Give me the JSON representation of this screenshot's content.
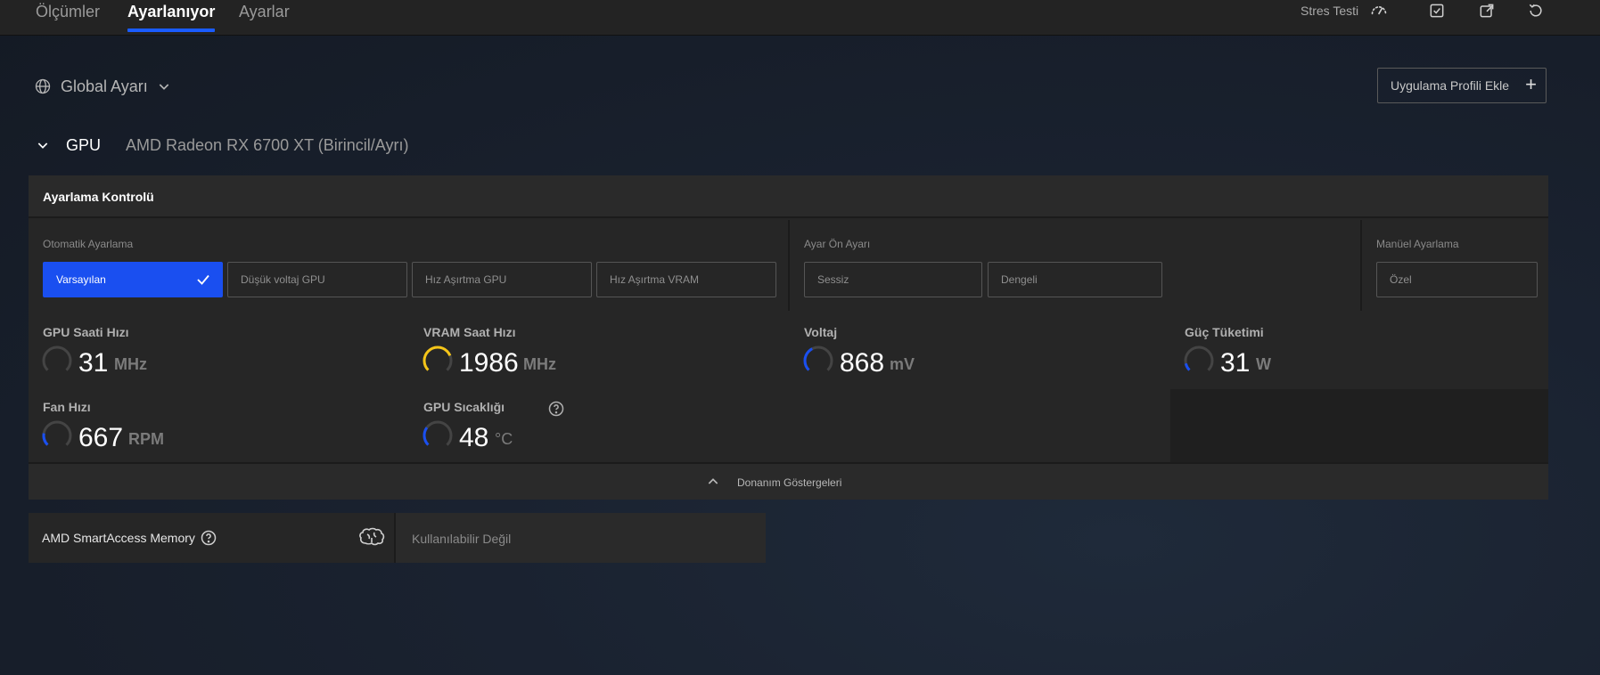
{
  "tabs": [
    {
      "label": "Ölçümler"
    },
    {
      "label": "Ayarlanıyor"
    },
    {
      "label": "Ayarlar"
    }
  ],
  "topbar": {
    "stress_test_label": "Stres Testi",
    "icons": [
      "gauge-icon",
      "apply-icon",
      "export-icon",
      "reset-icon"
    ]
  },
  "profile": {
    "global_label": "Global Ayarı",
    "add_profile_label": "Uygulama Profili Ekle"
  },
  "gpu": {
    "label": "GPU",
    "name": "AMD Radeon RX 6700 XT (Birincil/Ayrı)"
  },
  "tuning": {
    "title": "Ayarlama Kontrolü",
    "auto": {
      "label": "Otomatik Ayarlama",
      "options": [
        "Varsayılan",
        "Düşük voltaj GPU",
        "Hız Aşırtma GPU",
        "Hız Aşırtma VRAM"
      ],
      "selected": "Varsayılan"
    },
    "preset": {
      "label": "Ayar Ön Ayarı",
      "options": [
        "Sessiz",
        "Dengeli"
      ]
    },
    "manual": {
      "label": "Manüel Ayarlama",
      "options": [
        "Özel"
      ]
    }
  },
  "metrics": [
    {
      "label": "GPU Saati Hızı",
      "value": "31",
      "unit": "MHz",
      "gauge_color": "#444444",
      "gauge_fraction": 0.0
    },
    {
      "label": "VRAM Saat Hızı",
      "value": "1986",
      "unit": "MHz",
      "gauge_color": "#f5c518",
      "gauge_fraction": 0.75
    },
    {
      "label": "Voltaj",
      "value": "868",
      "unit": "mV",
      "gauge_color": "#1a4ff0",
      "gauge_fraction": 0.4
    },
    {
      "label": "Güç Tüketimi",
      "value": "31",
      "unit": "W",
      "gauge_color": "#1a4ff0",
      "gauge_fraction": 0.12
    },
    {
      "label": "Fan Hızı",
      "value": "667",
      "unit": "RPM",
      "gauge_color": "#1a4ff0",
      "gauge_fraction": 0.2
    },
    {
      "label": "GPU Sıcaklığı",
      "value": "48",
      "unit": "°C",
      "gauge_color": "#1a4ff0",
      "gauge_fraction": 0.3
    }
  ],
  "footer": {
    "label": "Donanım Göstergeleri"
  },
  "smart_access": {
    "label": "AMD SmartAccess Memory",
    "status": "Kullanılabilir Değil"
  },
  "colors": {
    "accent": "#1a4ff0",
    "warning": "#f5c518"
  }
}
